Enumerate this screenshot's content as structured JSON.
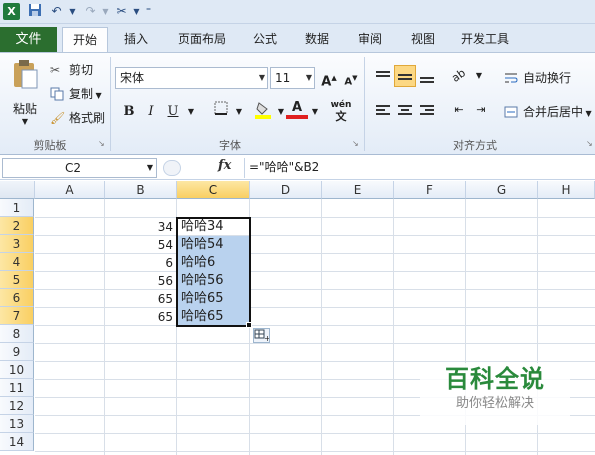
{
  "quick_access": {
    "icons": [
      "excel-logo",
      "save-icon",
      "undo-icon",
      "redo-icon",
      "tools-icon",
      "customize-icon"
    ]
  },
  "tabs": [
    "文件",
    "开始",
    "插入",
    "页面布局",
    "公式",
    "数据",
    "审阅",
    "视图",
    "开发工具"
  ],
  "ribbon": {
    "clipboard": {
      "paste": "粘贴",
      "cut": "剪切",
      "copy": "复制",
      "format_painter": "格式刷",
      "group": "剪贴板"
    },
    "font": {
      "font_name": "宋体",
      "font_size": "11",
      "bold": "B",
      "italic": "I",
      "underline": "U",
      "phonetic": "wén",
      "group": "字体"
    },
    "alignment": {
      "wrap_text": "自动换行",
      "merge_center": "合并后居中",
      "group": "对齐方式"
    }
  },
  "formula_bar": {
    "name_box": "C2",
    "fx": "fx",
    "formula": "=\"哈哈\"&B2"
  },
  "sheet": {
    "columns": [
      "A",
      "B",
      "C",
      "D",
      "E",
      "F",
      "G",
      "H"
    ],
    "rows": [
      "1",
      "2",
      "3",
      "4",
      "5",
      "6",
      "7",
      "8",
      "9",
      "10",
      "11",
      "12",
      "13",
      "14"
    ],
    "colB": [
      "34",
      "54",
      "6",
      "56",
      "65",
      "65"
    ],
    "colC": [
      "哈哈34",
      "哈哈54",
      "哈哈6",
      "哈哈56",
      "哈哈65",
      "哈哈65"
    ],
    "selected_column": "C"
  },
  "watermark": {
    "title": "百科全说",
    "subtitle": "助你轻松解决"
  },
  "colors": {
    "accent": "#2b6e2f",
    "selection": "#b9d2ee",
    "header_selected": "#f9cf62"
  }
}
